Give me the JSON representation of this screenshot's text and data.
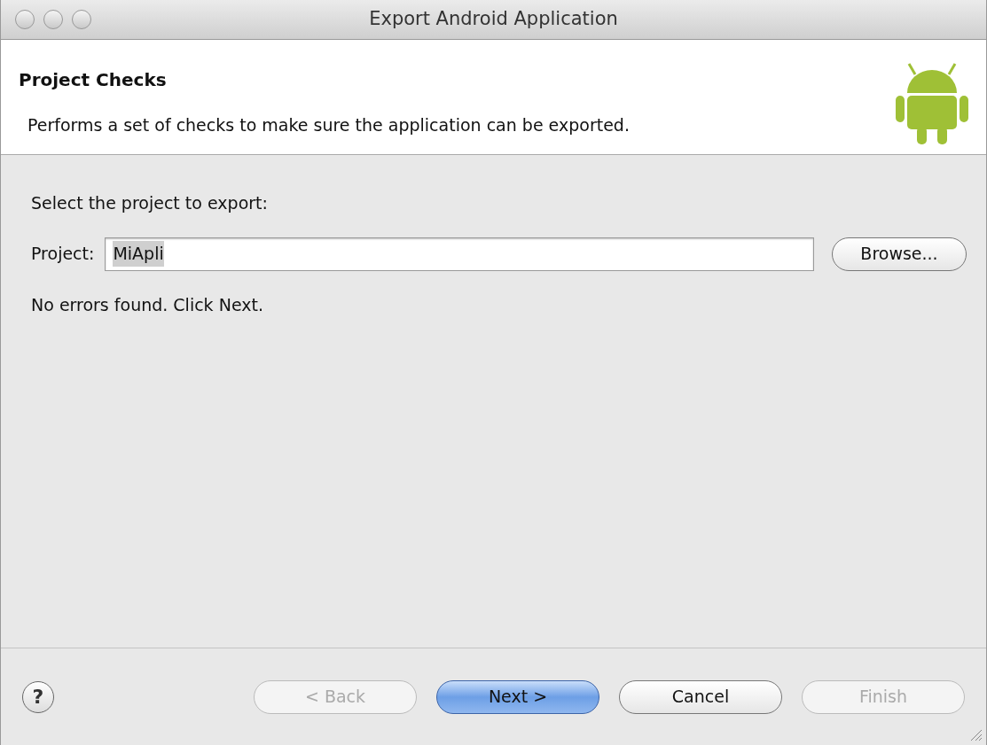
{
  "window": {
    "title": "Export Android Application"
  },
  "header": {
    "title": "Project Checks",
    "description": "Performs a set of checks to make sure the application can be exported."
  },
  "prompt": "Select the project to export:",
  "project_field": {
    "label": "Project:",
    "value": "MiApli",
    "text_selected": true
  },
  "browse_button": {
    "label": "Browse..."
  },
  "status": "No errors found. Click Next.",
  "buttons": [
    {
      "label": "< Back",
      "disabled": true,
      "default": false
    },
    {
      "label": "Next >",
      "disabled": false,
      "default": true
    },
    {
      "label": "Cancel",
      "disabled": false,
      "default": false
    },
    {
      "label": "Finish",
      "disabled": true,
      "default": false
    }
  ],
  "help_button": {
    "label": "?"
  }
}
